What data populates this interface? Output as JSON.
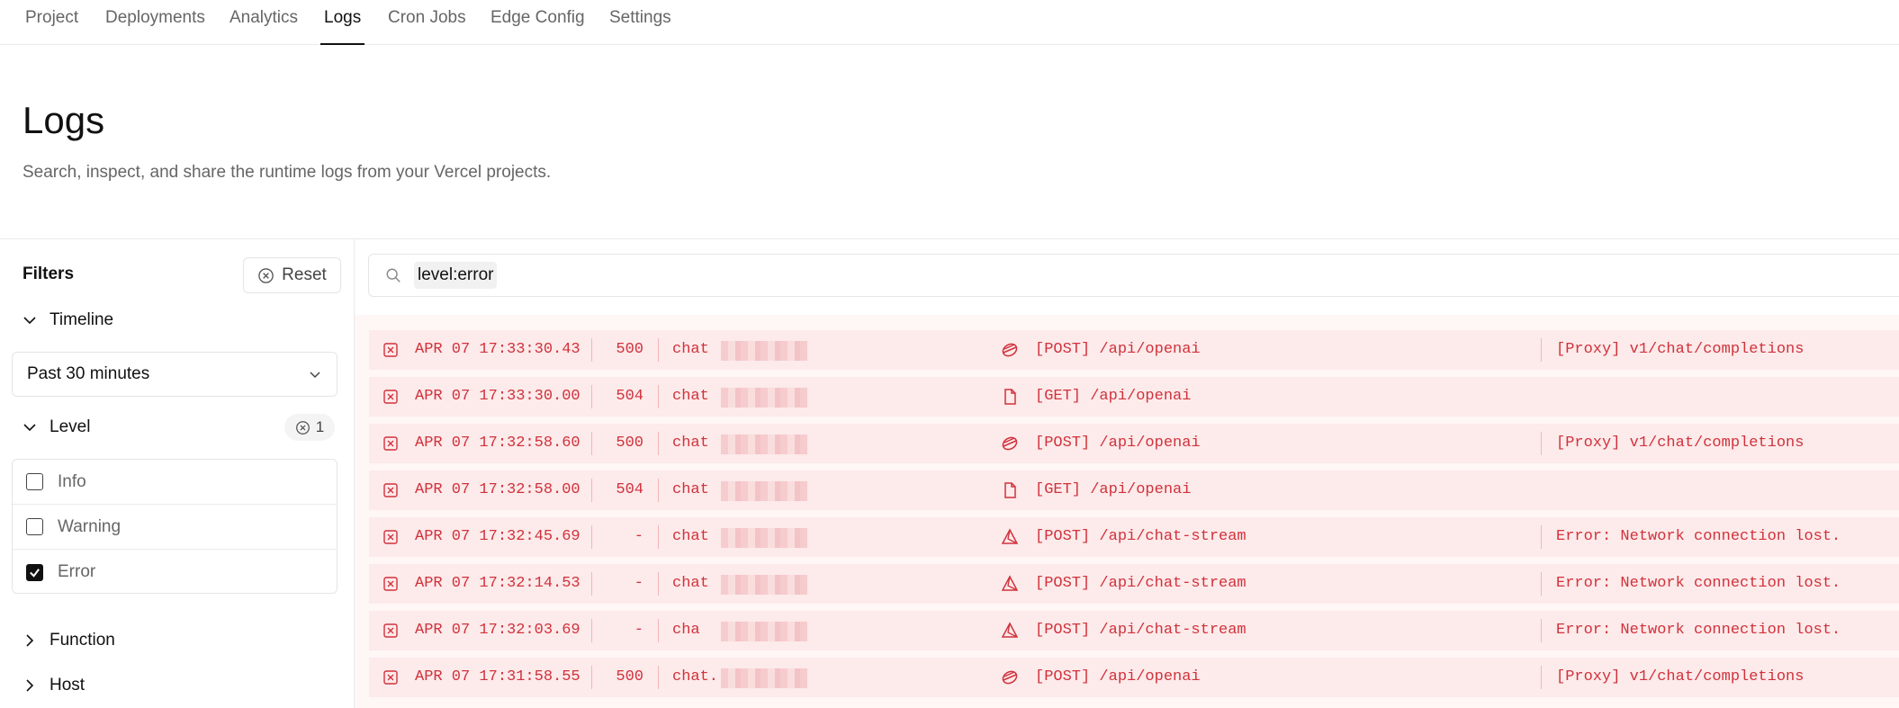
{
  "nav": {
    "tabs": [
      {
        "label": "Project"
      },
      {
        "label": "Deployments"
      },
      {
        "label": "Analytics"
      },
      {
        "label": "Logs",
        "active": true
      },
      {
        "label": "Cron Jobs"
      },
      {
        "label": "Edge Config"
      },
      {
        "label": "Settings"
      }
    ]
  },
  "header": {
    "title": "Logs",
    "subtitle": "Search, inspect, and share the runtime logs from your Vercel projects."
  },
  "sidebar": {
    "filters_title": "Filters",
    "reset_label": "Reset",
    "timeline_label": "Timeline",
    "timeline_value": "Past 30 minutes",
    "level_label": "Level",
    "level_count": "1",
    "levels": [
      {
        "label": "Info",
        "checked": false
      },
      {
        "label": "Warning",
        "checked": false
      },
      {
        "label": "Error",
        "checked": true
      }
    ],
    "function_label": "Function",
    "host_label": "Host"
  },
  "search": {
    "query": "level:error"
  },
  "colors": {
    "error": "#d0323c",
    "row_bg": "#fdeaea"
  },
  "logs": [
    {
      "time": "APR 07 17:33:30.43",
      "status": "500",
      "host": "chat",
      "icon": "proxy-icon",
      "request": "[POST] /api/openai",
      "message": "[Proxy] v1/chat/completions"
    },
    {
      "time": "APR 07 17:33:30.00",
      "status": "504",
      "host": "chat",
      "icon": "file-icon",
      "request": "[GET] /api/openai",
      "message": ""
    },
    {
      "time": "APR 07 17:32:58.60",
      "status": "500",
      "host": "chat",
      "icon": "proxy-icon",
      "request": "[POST] /api/openai",
      "message": "[Proxy] v1/chat/completions"
    },
    {
      "time": "APR 07 17:32:58.00",
      "status": "504",
      "host": "chat",
      "icon": "file-icon",
      "request": "[GET] /api/openai",
      "message": ""
    },
    {
      "time": "APR 07 17:32:45.69",
      "status": "-",
      "host": "chat",
      "icon": "edge-function-icon",
      "request": "[POST] /api/chat-stream",
      "message": "Error: Network connection lost."
    },
    {
      "time": "APR 07 17:32:14.53",
      "status": "-",
      "host": "chat",
      "icon": "edge-function-icon",
      "request": "[POST] /api/chat-stream",
      "message": "Error: Network connection lost."
    },
    {
      "time": "APR 07 17:32:03.69",
      "status": "-",
      "host": "cha",
      "icon": "edge-function-icon",
      "request": "[POST] /api/chat-stream",
      "message": "Error: Network connection lost."
    },
    {
      "time": "APR 07 17:31:58.55",
      "status": "500",
      "host": "chat.",
      "icon": "proxy-icon",
      "request": "[POST] /api/openai",
      "message": "[Proxy] v1/chat/completions"
    }
  ]
}
